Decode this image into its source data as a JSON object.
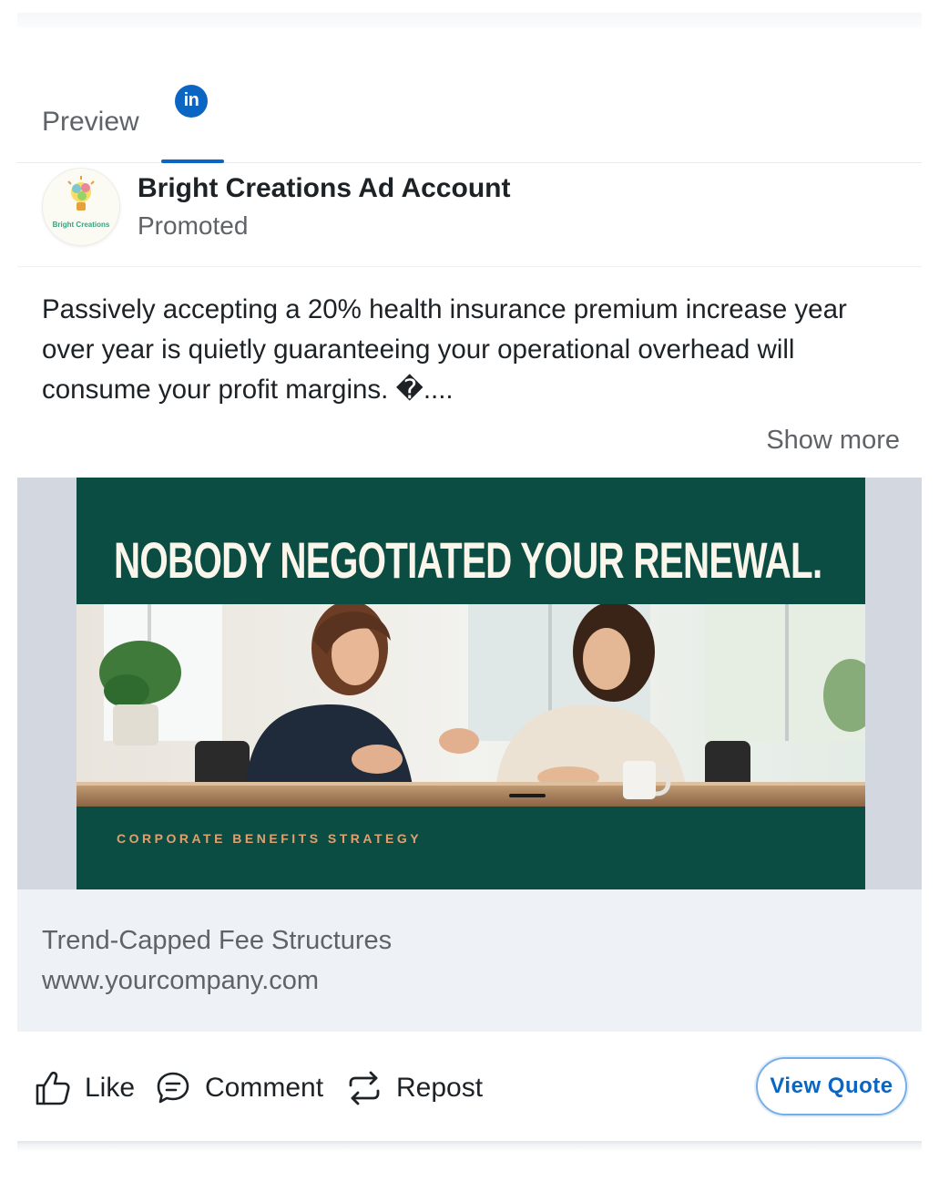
{
  "tabs": {
    "preview_label": "Preview",
    "linkedin_icon_text": "in",
    "active": "linkedin"
  },
  "post": {
    "account_name": "Bright Creations Ad Account",
    "subtitle": "Promoted",
    "avatar_text": "Bright Creations",
    "text": "Passively accepting a 20% health insurance premium increase year over year is quietly guaranteeing your operational overhead will consume your profit margins. �....",
    "show_more": "Show more"
  },
  "creative": {
    "headline": "NOBODY NEGOTIATED YOUR RENEWAL.",
    "tagline": "CORPORATE BENEFITS STRATEGY"
  },
  "link": {
    "title": "Trend-Capped Fee Structures",
    "url": "www.yourcompany.com"
  },
  "actions": {
    "like": "Like",
    "comment": "Comment",
    "repost": "Repost",
    "cta": "View Quote"
  },
  "colors": {
    "linkedin_blue": "#0a66c2",
    "creative_green": "#0c4d43",
    "tagline_orange": "#e0a070",
    "link_box_bg": "#eef2f7"
  }
}
